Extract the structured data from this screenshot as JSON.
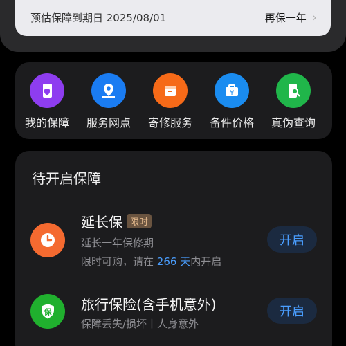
{
  "device_card": {
    "expiry_label": "预估保障到期日 2025/08/01",
    "renew_label": "再保一年"
  },
  "services": [
    {
      "label": "我的保障",
      "icon": "phone-shield-icon",
      "color": "#8e3df0"
    },
    {
      "label": "服务网点",
      "icon": "location-map-icon",
      "color": "#1a7cf2"
    },
    {
      "label": "寄修服务",
      "icon": "package-icon",
      "color": "#f66a18"
    },
    {
      "label": "备件价格",
      "icon": "price-tag-box-icon",
      "color": "#1a8cf0"
    },
    {
      "label": "真伪查询",
      "icon": "phone-search-icon",
      "color": "#20b64a"
    }
  ],
  "pending": {
    "title": "待开启保障",
    "items": [
      {
        "title": "延长保",
        "badge": "限时",
        "subtitle": "延长一年保修期",
        "note_prefix": "限时可购，请在 ",
        "note_days": "266 天",
        "note_suffix": "内开启",
        "button": "开启",
        "icon": "clock-icon",
        "color": "#f46a30"
      },
      {
        "title": "旅行保险(含手机意外)",
        "subtitle": "保障丢失/损坏丨人身意外",
        "button": "开启",
        "icon": "insurance-shield-icon",
        "icon_text": "保",
        "color": "#20b02e"
      }
    ]
  }
}
